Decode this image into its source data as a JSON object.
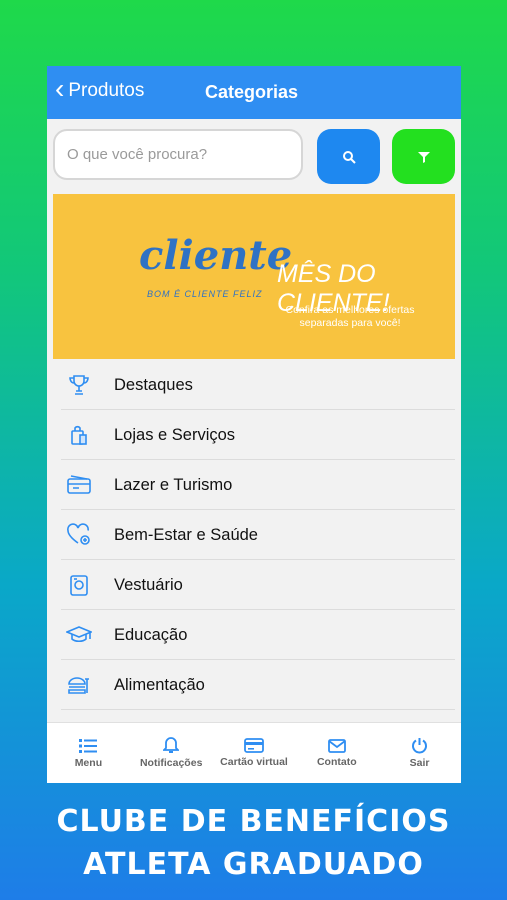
{
  "navbar": {
    "back_label": "Produtos",
    "title": "Categorias"
  },
  "search": {
    "placeholder": "O que você procura?"
  },
  "banner": {
    "logo_word": "cliente",
    "logo_tagline": "BOM É CLIENTE FELIZ",
    "headline": "MÊS DO CLIENTE!",
    "description": "Confira as melhores ofertas separadas para você!"
  },
  "categories": [
    {
      "label": "Destaques",
      "icon": "trophy-icon"
    },
    {
      "label": "Lojas e Serviços",
      "icon": "shopping-bag-icon"
    },
    {
      "label": "Lazer e Turismo",
      "icon": "ticket-icon"
    },
    {
      "label": "Bem-Estar e Saúde",
      "icon": "heart-health-icon"
    },
    {
      "label": "Vestuário",
      "icon": "clothing-tag-icon"
    },
    {
      "label": "Educação",
      "icon": "graduation-cap-icon"
    },
    {
      "label": "Alimentação",
      "icon": "burger-icon"
    }
  ],
  "tabbar": [
    {
      "label": "Menu",
      "icon": "list-icon"
    },
    {
      "label": "Notificações",
      "icon": "bell-icon"
    },
    {
      "label": "Cartão virtual",
      "icon": "card-icon"
    },
    {
      "label": "Contato",
      "icon": "mail-icon"
    },
    {
      "label": "Sair",
      "icon": "power-icon"
    }
  ],
  "footer": {
    "line1": "CLUBE DE BENEFÍCIOS",
    "line2": "ATLETA GRADUADO"
  },
  "colors": {
    "primary": "#2f8ef2",
    "filter_green": "#23e01f",
    "banner_yellow": "#f8c33f"
  }
}
